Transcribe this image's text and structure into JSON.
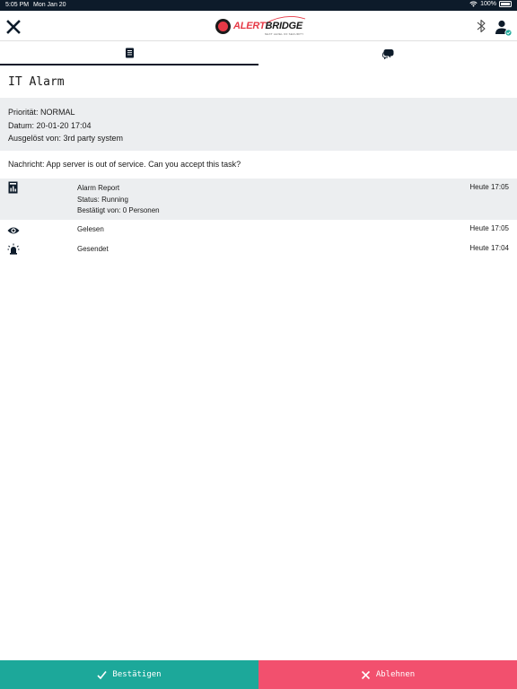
{
  "status_bar": {
    "time": "5:05 PM",
    "date": "Mon Jan 20",
    "battery": "100%",
    "icons": [
      "wifi-icon",
      "battery-icon"
    ]
  },
  "header": {
    "logo": {
      "text_main": "ALERT",
      "text_accent": "BRIDGE",
      "tagline": "NEXT LEVEL OF SECURITY"
    },
    "icons": [
      "close-icon",
      "bluetooth-icon",
      "user-connected-icon"
    ]
  },
  "tabs": [
    {
      "icon": "document-icon",
      "active": true
    },
    {
      "icon": "chat-icon",
      "active": false
    }
  ],
  "alarm": {
    "title": "IT Alarm",
    "priority": "Priorität: NORMAL",
    "date": "Datum: 20-01-20 17:04",
    "triggered_by": "Ausgelöst von: 3rd party system",
    "message": "Nachricht: App server is out of service. Can you accept this task?"
  },
  "log": [
    {
      "icon": "report-icon",
      "lines": [
        "Alarm Report",
        "Status: Running",
        "Bestätigt von: 0 Personen"
      ],
      "time": "Heute 17:05"
    },
    {
      "icon": "eye-icon",
      "lines": [
        "Gelesen"
      ],
      "time": "Heute 17:05"
    },
    {
      "icon": "alarm-bell-icon",
      "lines": [
        "Gesendet"
      ],
      "time": "Heute 17:04"
    }
  ],
  "actions": {
    "accept_label": "Bestätigen",
    "reject_label": "Ablehnen"
  },
  "colors": {
    "accept": "#1ca89a",
    "reject": "#f2506e",
    "brand_red": "#e63946",
    "dark": "#0d1b2a",
    "info_bg": "#eceef0"
  }
}
